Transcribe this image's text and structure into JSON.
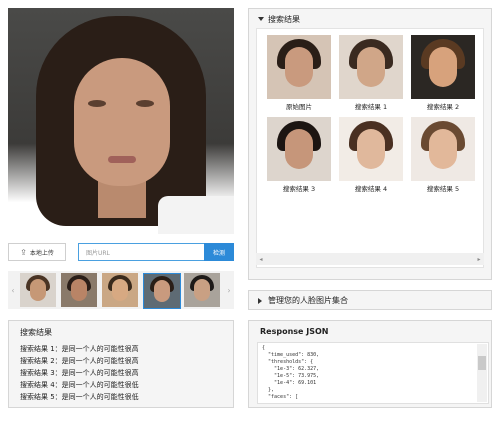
{
  "upload": {
    "label": "本地上传"
  },
  "url_input": {
    "placeholder": "图片URL"
  },
  "detect_button": {
    "label": "检测"
  },
  "left_results": {
    "title": "搜索结果",
    "lines": [
      "搜索结果 1：是同一个人的可能性很高",
      "搜索结果 2：是同一个人的可能性很高",
      "搜索结果 3：是同一个人的可能性很高",
      "搜索结果 4：是同一个人的可能性很低",
      "搜索结果 5：是同一个人的可能性很低"
    ]
  },
  "search_panel": {
    "title": "搜索结果",
    "results": [
      {
        "caption": "原始图片"
      },
      {
        "caption": "搜索结果 1"
      },
      {
        "caption": "搜索结果 2"
      },
      {
        "caption": "搜索结果 3"
      },
      {
        "caption": "搜索结果 4"
      },
      {
        "caption": "搜索结果 5"
      }
    ]
  },
  "manage_panel": {
    "title": "管理您的人脸图片集合"
  },
  "json_panel": {
    "title": "Response JSON",
    "lines": [
      "{",
      "  \"time_used\": 830,",
      "  \"thresholds\": {",
      "    \"1e-3\": 62.327,",
      "    \"1e-5\": 73.975,",
      "    \"1e-4\": 69.101",
      "  },",
      "  \"faces\": ["
    ]
  },
  "icons": {
    "upload": "upload-icon",
    "prev": "chevron-left-icon",
    "next": "chevron-right-icon",
    "expand": "triangle-down-icon",
    "collapse": "triangle-right-icon"
  },
  "colors": {
    "accent": "#2c8ad8",
    "input_border": "#4aa0e0"
  }
}
